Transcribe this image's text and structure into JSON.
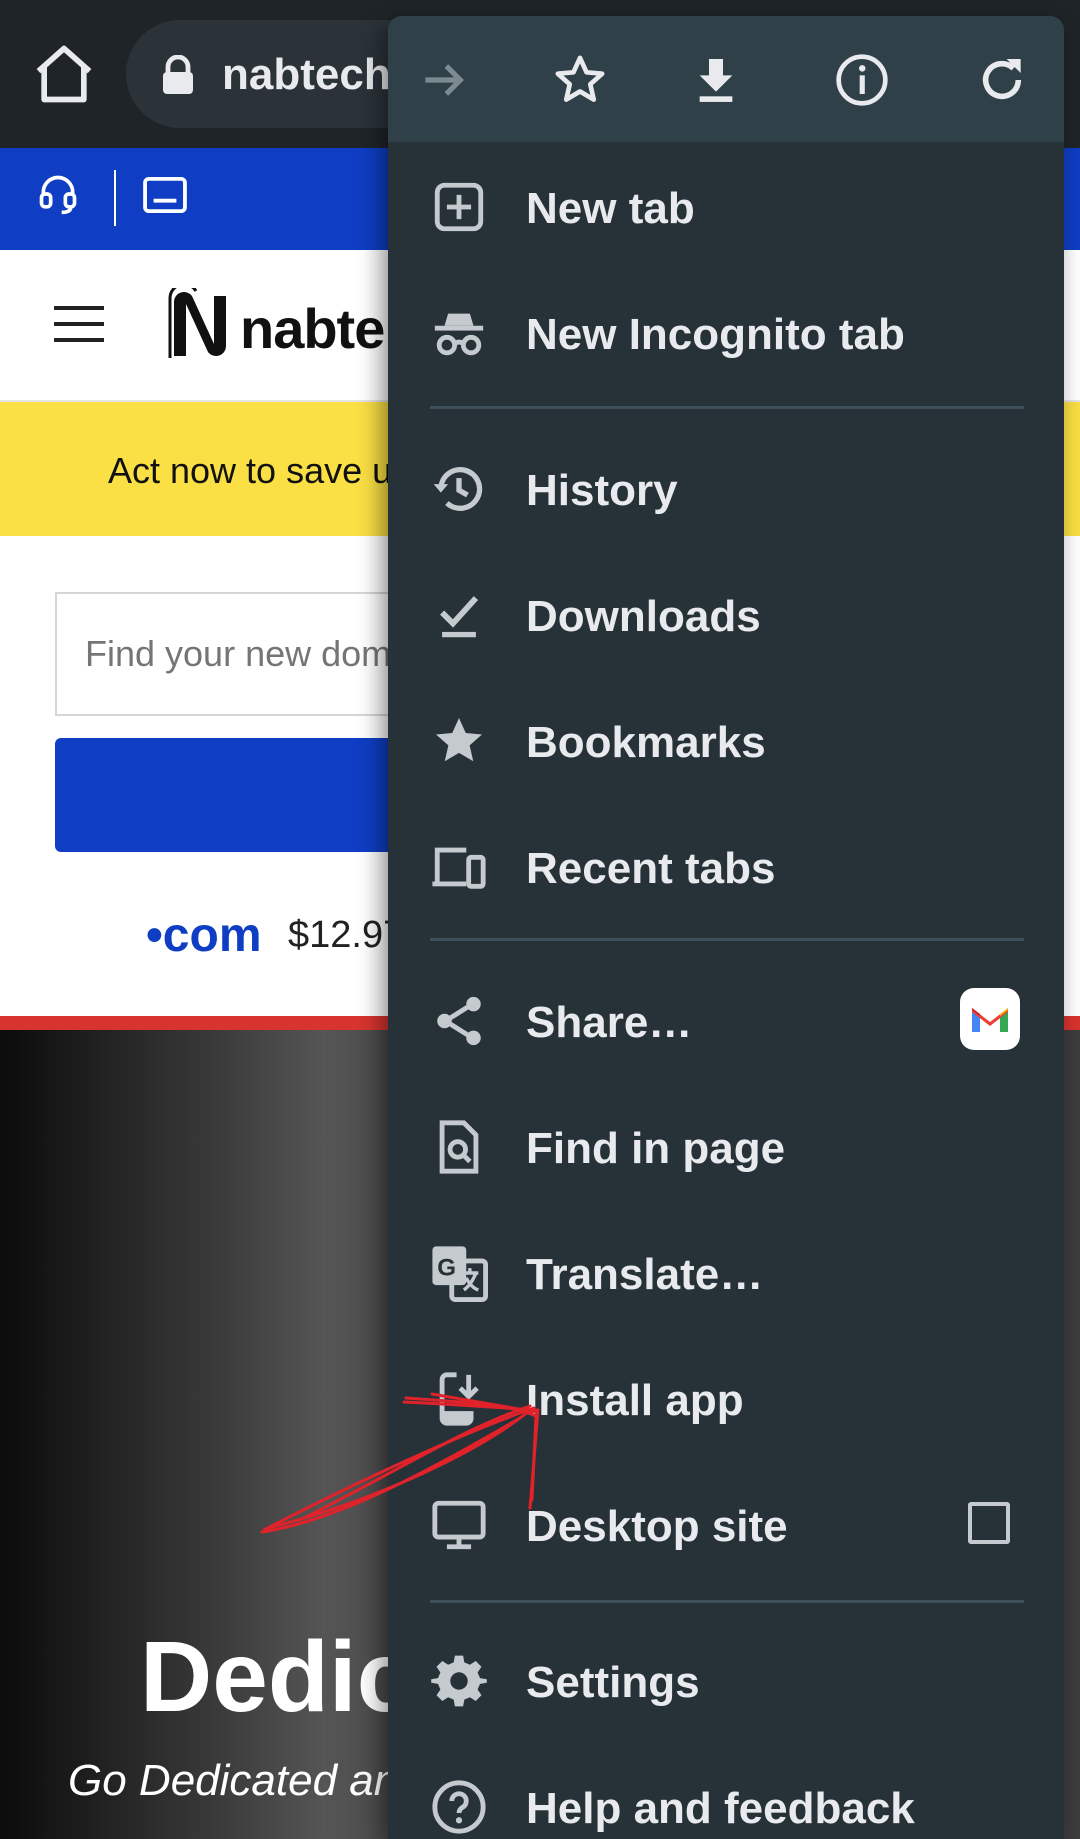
{
  "browser": {
    "url_text": "nabtech"
  },
  "site": {
    "logo_text": "nabte",
    "promo_text": "Act now to save u",
    "domain_search_placeholder": "Find your new dom",
    "com_tld": "•com",
    "com_price": "$12.97",
    "hero_title": "Dedic",
    "hero_subtitle": "Go Dedicated an",
    "colors": {
      "brand_blue": "#0f3ec4",
      "promo_yellow": "#fae044",
      "accent_red": "#d8342f"
    }
  },
  "menu": {
    "toolbar_icons": [
      "forward-icon",
      "bookmark-star-icon",
      "download-icon",
      "info-icon",
      "reload-icon"
    ],
    "items": [
      {
        "id": "new-tab",
        "label": "New tab",
        "icon": "new-tab-icon"
      },
      {
        "id": "new-incognito-tab",
        "label": "New Incognito tab",
        "icon": "incognito-icon"
      },
      {
        "id": "history",
        "label": "History",
        "icon": "history-icon"
      },
      {
        "id": "downloads",
        "label": "Downloads",
        "icon": "downloads-check-icon"
      },
      {
        "id": "bookmarks",
        "label": "Bookmarks",
        "icon": "star-icon"
      },
      {
        "id": "recent-tabs",
        "label": "Recent tabs",
        "icon": "devices-icon"
      },
      {
        "id": "share",
        "label": "Share…",
        "icon": "share-icon"
      },
      {
        "id": "find-in-page",
        "label": "Find in page",
        "icon": "find-in-page-icon"
      },
      {
        "id": "translate",
        "label": "Translate…",
        "icon": "translate-icon"
      },
      {
        "id": "install-app",
        "label": "Install app",
        "icon": "install-app-icon"
      },
      {
        "id": "desktop-site",
        "label": "Desktop site",
        "icon": "desktop-icon",
        "checked": false
      },
      {
        "id": "settings",
        "label": "Settings",
        "icon": "gear-icon"
      },
      {
        "id": "help-feedback",
        "label": "Help and feedback",
        "icon": "help-icon"
      }
    ],
    "colors": {
      "background": "#263238",
      "toolbar": "#2f4049",
      "text": "#e8eaed"
    }
  }
}
